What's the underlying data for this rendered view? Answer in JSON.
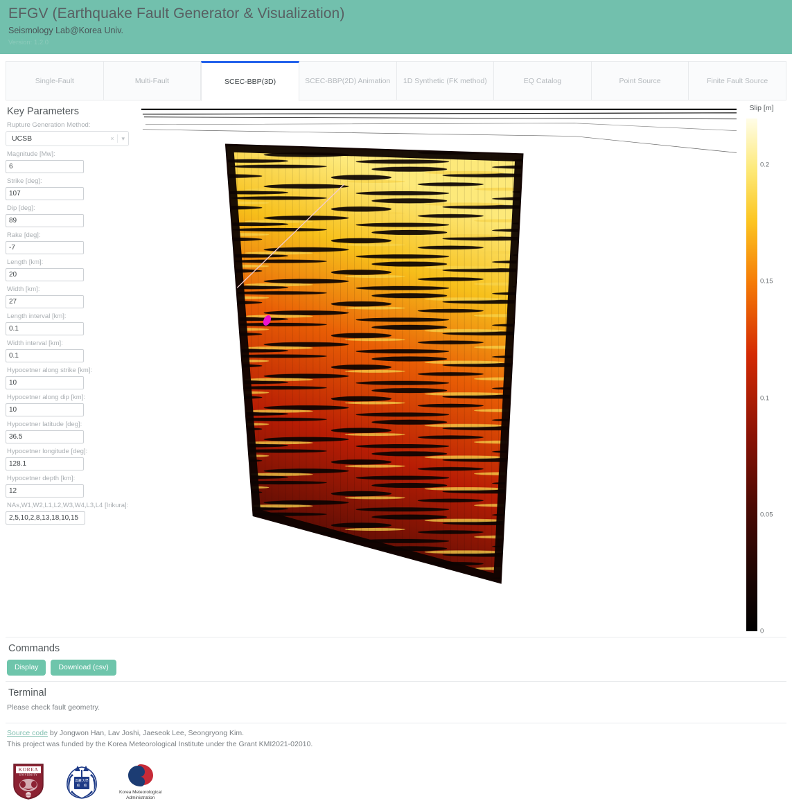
{
  "header": {
    "title": "EFGV (Earthquake Fault Generator & Visualization)",
    "subtitle": "Seismology Lab@Korea Univ.",
    "version": "Version: 1.2.0",
    "brand_color": "#72c0ad"
  },
  "tabs": [
    {
      "label": "Single-Fault",
      "active": false
    },
    {
      "label": "Multi-Fault",
      "active": false
    },
    {
      "label": "SCEC-BBP(3D)",
      "active": true
    },
    {
      "label": "SCEC-BBP(2D) Animation",
      "active": false
    },
    {
      "label": "1D Synthetic (FK method)",
      "active": false
    },
    {
      "label": "EQ Catalog",
      "active": false
    },
    {
      "label": "Point Source",
      "active": false
    },
    {
      "label": "Finite Fault Source",
      "active": false
    }
  ],
  "params": {
    "section_title": "Key Parameters",
    "method": {
      "label": "Rupture Generation Method:",
      "value": "UCSB",
      "clear_icon": "×",
      "caret_icon": "▾"
    },
    "fields": [
      {
        "label": "Magnitude [Mw]:",
        "value": "6",
        "name": "magnitude"
      },
      {
        "label": "Strike [deg]:",
        "value": "107",
        "name": "strike"
      },
      {
        "label": "Dip [deg]:",
        "value": "89",
        "name": "dip"
      },
      {
        "label": "Rake [deg]:",
        "value": "-7",
        "name": "rake"
      },
      {
        "label": "Length [km]:",
        "value": "20",
        "name": "length"
      },
      {
        "label": "Width [km]:",
        "value": "27",
        "name": "width"
      },
      {
        "label": "Length interval [km]:",
        "value": "0.1",
        "name": "length-interval"
      },
      {
        "label": "Width interval [km]:",
        "value": "0.1",
        "name": "width-interval"
      },
      {
        "label": "Hypocetner along strike [km]:",
        "value": "10",
        "name": "hypocenter-along-strike"
      },
      {
        "label": "Hypocetner along dip [km]:",
        "value": "10",
        "name": "hypocenter-along-dip"
      },
      {
        "label": "Hypocetner latitude [deg]:",
        "value": "36.5",
        "name": "hypocenter-latitude"
      },
      {
        "label": "Hypocetner longitude [deg]:",
        "value": "128.1",
        "name": "hypocenter-longitude"
      },
      {
        "label": "Hypocetner depth [km]:",
        "value": "12",
        "name": "hypocenter-depth"
      },
      {
        "label": "NAs,W1,W2,L1,L2,W3,W4,L3,L4 [Irikura]:",
        "value": "2,5,10,2,8,13,18,10,15",
        "name": "irikura-params"
      }
    ]
  },
  "chart_data": {
    "type": "heatmap",
    "title": "",
    "colorbar_title": "Slip [m]",
    "ticks": [
      "0",
      "0.05",
      "0.1",
      "0.15",
      "0.2"
    ],
    "tick_values": [
      0,
      0.05,
      0.1,
      0.15,
      0.2
    ],
    "zlim": [
      0,
      0.22
    ],
    "colormap": "hot",
    "grid": false,
    "legend": "right",
    "markers": [
      {
        "name": "hypocenter",
        "color": "#e818c8"
      },
      {
        "name": "rupture-trace-line",
        "color": "#f0c8c8"
      }
    ],
    "axes_description": "3D fault plane surface viewed near edge-on; slip distribution colored by hot colormap"
  },
  "commands": {
    "title": "Commands",
    "display_label": "Display",
    "download_label": "Download (csv)"
  },
  "terminal": {
    "title": "Terminal",
    "message": "Please check fault geometry."
  },
  "footer": {
    "source_link": "Source code",
    "credit_rest": " by Jongwon Han, Lav Joshi, Jaeseok Lee, Seongryong Kim.",
    "funding": "This project was funded by the Korea Meteorological Institute under the Grant KMI2021-02010.",
    "kma_label_line1": "Korea Meteorological",
    "kma_label_line2": "Administration",
    "ku_logo_text_top": "KOREA",
    "ku_logo_text_bottom": "UNIVERSITY"
  }
}
